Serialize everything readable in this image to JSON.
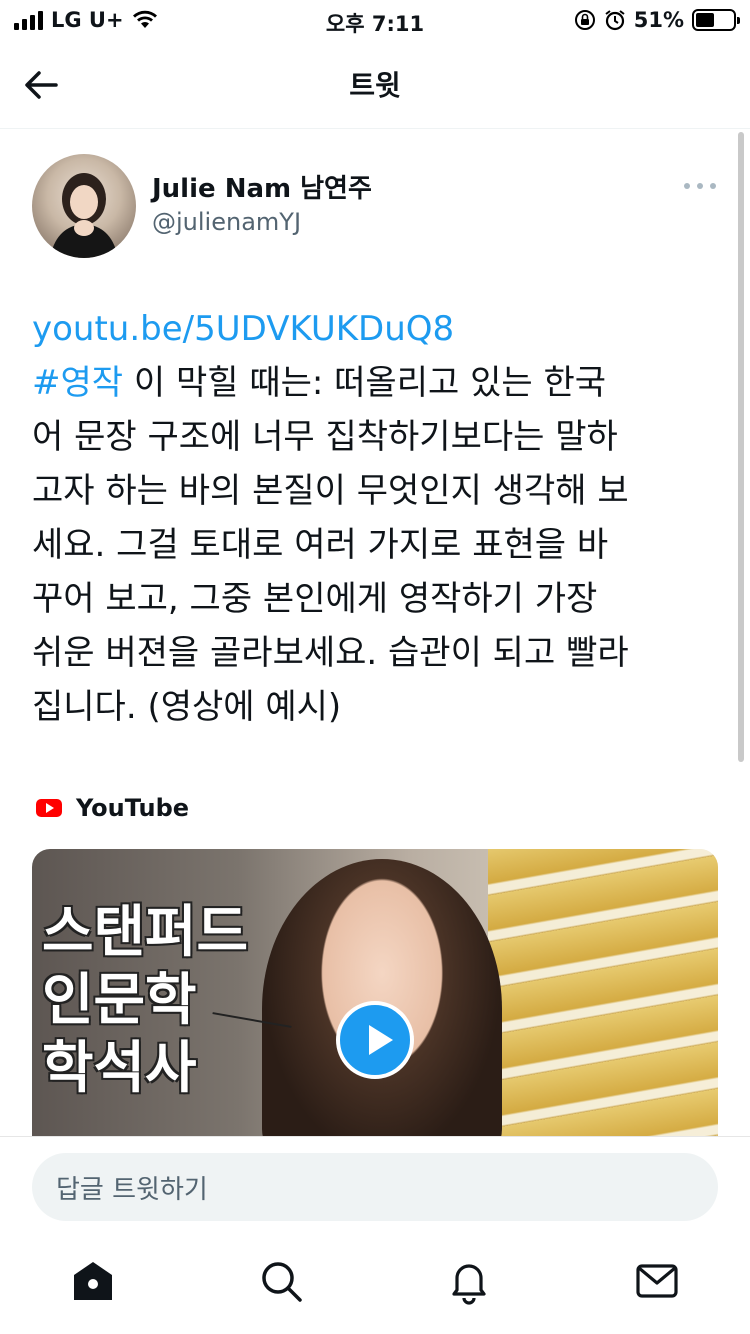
{
  "status_bar": {
    "carrier": "LG U+",
    "time": "오후 7:11",
    "battery": "51%",
    "battery_level": 0.51
  },
  "header": {
    "title": "트윗",
    "back_icon": "arrow-left-icon"
  },
  "tweet": {
    "author_name": "Julie Nam 남연주",
    "author_handle": "@julienamYJ",
    "link": "youtu.be/5UDVKUKDuQ8",
    "hashtag": "#영작",
    "line1_rest": " 이 막힐 때는: 떠올리고 있는 한국",
    "line2": "어 문장 구조에 너무 집착하기보다는 말하",
    "line3": "고자 하는 바의 본질이 무엇인지 생각해 보",
    "line4": "세요. 그걸 토대로 여러 가지로 표현을 바",
    "line5": "꾸어 보고, 그중 본인에게 영작하기 가장",
    "line6": "쉬운 버젼을 골라보세요. 습관이 되고 빨라",
    "line7": "집니다. (영상에 예시)"
  },
  "source": {
    "label": "YouTube",
    "icon": "youtube-icon"
  },
  "card": {
    "overlay_line1": "스탠퍼드",
    "overlay_line2": "인문학",
    "overlay_line3": "학석사",
    "play_icon": "play-icon"
  },
  "reply": {
    "placeholder": "답글 트윗하기"
  },
  "bottom_nav": {
    "items": [
      "home-icon",
      "search-icon",
      "notifications-icon",
      "messages-icon"
    ]
  },
  "colors": {
    "accent": "#1d9bf0",
    "text": "#0f1419",
    "muted": "#536471"
  }
}
